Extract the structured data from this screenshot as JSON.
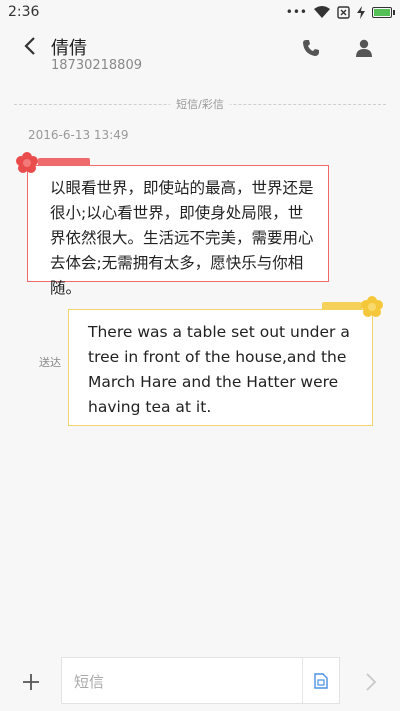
{
  "status_bar": {
    "time": "2:36",
    "icons": [
      "more-dots-icon",
      "wifi-icon",
      "sim-disabled-icon",
      "charging-icon",
      "battery-icon"
    ],
    "dots": "•••",
    "battery_color": "#55c057"
  },
  "header": {
    "contact_name": "倩倩",
    "contact_number": "18730218809",
    "back_icon": "back-arrow-icon",
    "call_icon": "phone-icon",
    "contact_icon": "person-icon"
  },
  "conversation": {
    "divider_label": "短信/彩信",
    "timestamp": "2016-6-13 13:49",
    "incoming_message": "以眼看世界，即使站的最高，世界还是很小;以心看世界，即使身处局限，世界依然很大。生活远不完美，需要用心去体会;无需拥有太多，愿快乐与你相随。",
    "outgoing_message": "There was a table set out under a tree in front of the house,and the March Hare and the Hatter were having tea at it.",
    "delivered_label": "送达",
    "incoming_accent": "#f06a6a",
    "outgoing_accent": "#f3d36e"
  },
  "composer": {
    "placeholder": "短信",
    "value": "",
    "add_icon": "plus-icon",
    "sim_icon": "sim-card-icon",
    "send_icon": "send-chevron-icon"
  }
}
